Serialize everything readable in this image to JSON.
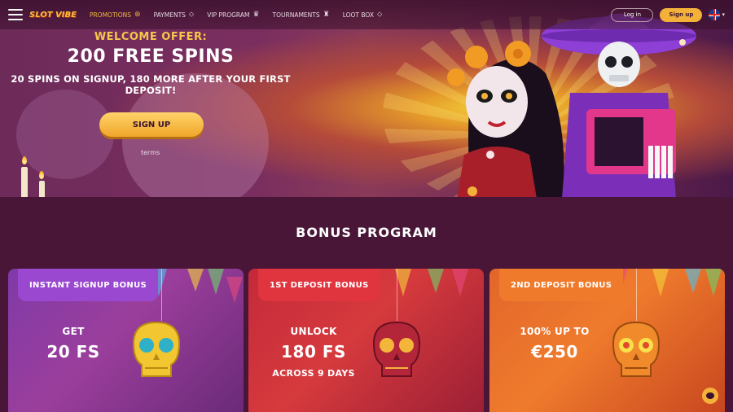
{
  "header": {
    "logo_text": "SLOT VIBE",
    "nav": [
      {
        "label": "PROMOTIONS",
        "icon": "gift-icon",
        "active": true
      },
      {
        "label": "PAYMENTS",
        "icon": "tag-icon",
        "active": false
      },
      {
        "label": "VIP PROGRAM",
        "icon": "crown-icon",
        "active": false
      },
      {
        "label": "TOURNAMENTS",
        "icon": "trophy-icon",
        "active": false
      },
      {
        "label": "LOOT BOX",
        "icon": "tag-icon",
        "active": false
      }
    ],
    "login_label": "Log in",
    "signup_label": "Sign up",
    "language": "UK flag"
  },
  "hero": {
    "welcome": "WELCOME OFFER:",
    "title": "200 FREE SPINS",
    "subtitle": "20 SPINS ON SIGNUP, 180 MORE AFTER YOUR FIRST DEPOSIT!",
    "cta": "SIGN UP",
    "terms": "terms"
  },
  "bonus": {
    "title": "BONUS PROGRAM",
    "cards": [
      {
        "tag": "INSTANT SIGNUP BONUS",
        "line1": "GET",
        "line2": "20 FS",
        "line3": ""
      },
      {
        "tag": "1ST DEPOSIT BONUS",
        "line1": "UNLOCK",
        "line2": "180 FS",
        "line3": "ACROSS 9 DAYS"
      },
      {
        "tag": "2ND DEPOSIT BONUS",
        "line1": "100% UP TO",
        "line2": "€250",
        "line3": ""
      }
    ]
  },
  "colors": {
    "accent": "#f4b13a",
    "background": "#4a1638",
    "card1": "#8b3aa8",
    "card2": "#d0303c",
    "card3": "#ec732b"
  }
}
